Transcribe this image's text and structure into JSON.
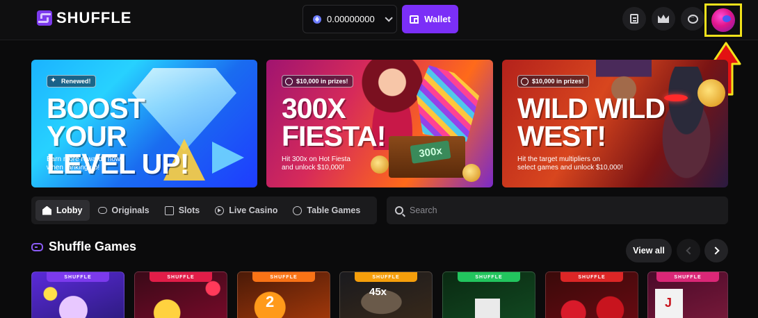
{
  "header": {
    "logo_text": "SHUFFLE",
    "balance": "0.00000000",
    "wallet_label": "Wallet"
  },
  "banners": [
    {
      "badge": "Renewed!",
      "title": "BOOST YOUR\nLEVEL UP!",
      "subtitle": "Earn more rewards now\nwhen ranking up!"
    },
    {
      "badge": "$10,000 in prizes!",
      "title": "300X\nFIESTA!",
      "subtitle": "Hit 300x on Hot Fiesta\nand unlock $10,000!",
      "chest_label": "300x"
    },
    {
      "badge": "$10,000 in prizes!",
      "title": "WILD WILD\nWEST!",
      "subtitle": "Hit the target multipliers on\nselect games and unlock $10,000!"
    }
  ],
  "tabs": [
    {
      "label": "Lobby",
      "icon": "home-icon"
    },
    {
      "label": "Originals",
      "icon": "gamepad-icon"
    },
    {
      "label": "Slots",
      "icon": "slots-icon"
    },
    {
      "label": "Live Casino",
      "icon": "play-icon"
    },
    {
      "label": "Table Games",
      "icon": "chip-icon"
    }
  ],
  "search": {
    "placeholder": "Search"
  },
  "section": {
    "title": "Shuffle Games",
    "view_all": "View all"
  },
  "cards": [
    {
      "tag": "SHUFFLE",
      "tag_color": "#7c3aed"
    },
    {
      "tag": "SHUFFLE",
      "tag_color": "#e11d48"
    },
    {
      "tag": "SHUFFLE",
      "tag_color": "#f97316",
      "art_text": "2"
    },
    {
      "tag": "SHUFFLE",
      "tag_color": "#f59e0b",
      "art_text": "45x"
    },
    {
      "tag": "SHUFFLE",
      "tag_color": "#22c55e"
    },
    {
      "tag": "SHUFFLE",
      "tag_color": "#dc2626"
    },
    {
      "tag": "SHUFFLE",
      "tag_color": "#db2777",
      "art_text": "J"
    }
  ]
}
